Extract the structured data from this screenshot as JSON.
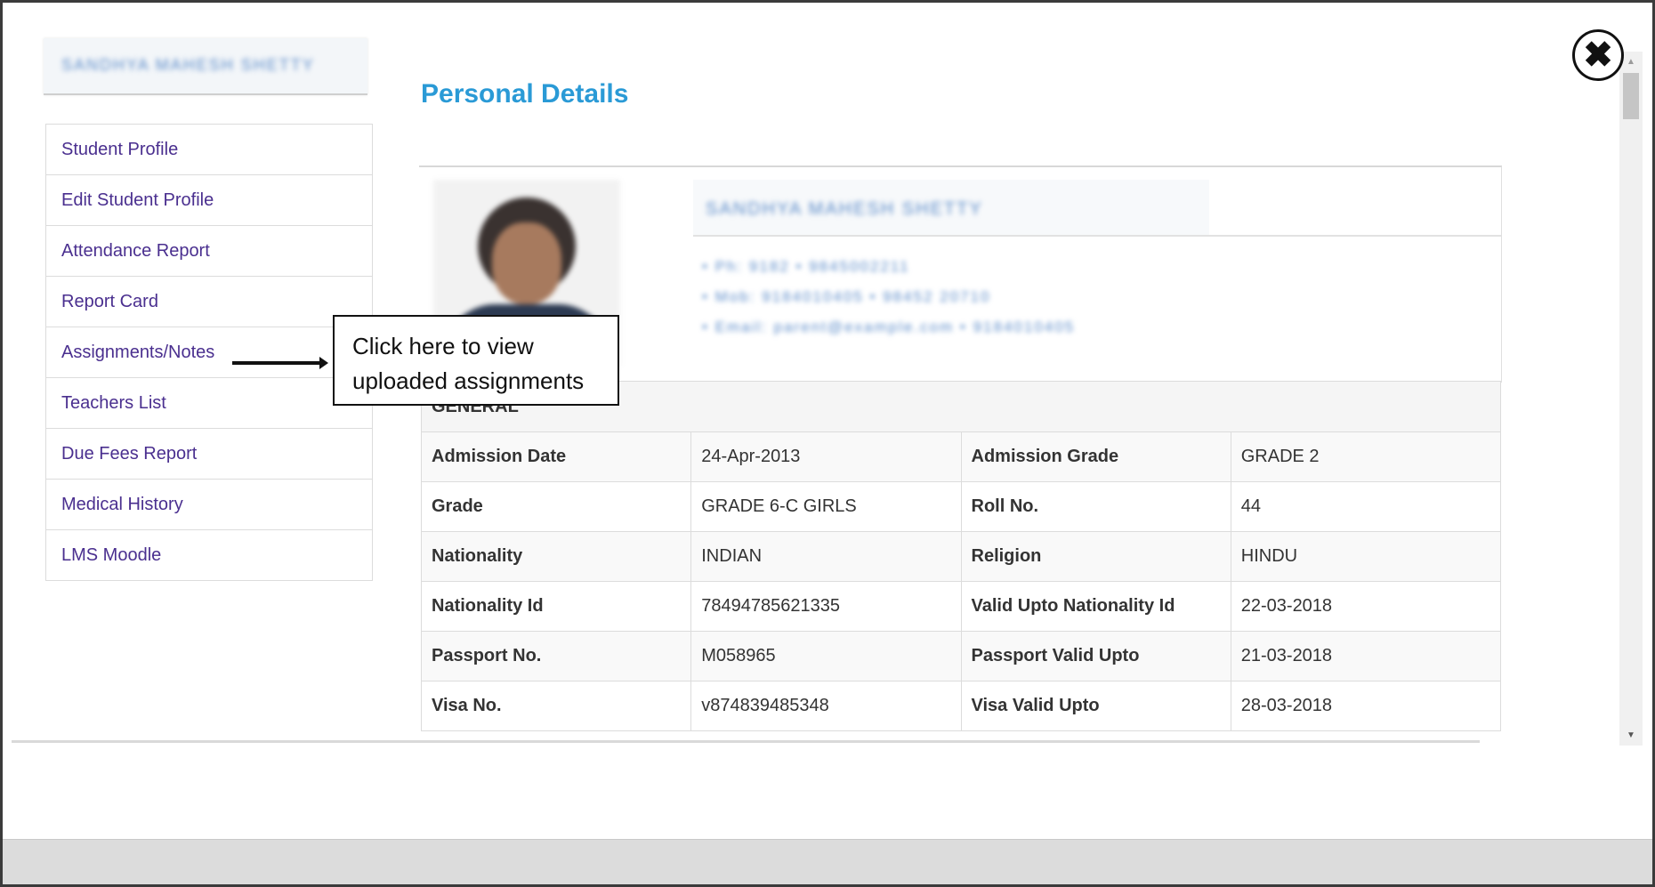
{
  "student": {
    "name_blurred": "SANDHYA MAHESH SHETTY",
    "detail_line_1": "• Ph: 9182 • 9845002211",
    "detail_line_2": "• Mob: 9184010405 • 98452 20710",
    "detail_line_3": "• Email: parent@example.com • 9184010405"
  },
  "sidebar": {
    "items": [
      {
        "label": "Student Profile"
      },
      {
        "label": "Edit Student Profile"
      },
      {
        "label": "Attendance Report"
      },
      {
        "label": "Report Card"
      },
      {
        "label": "Assignments/Notes"
      },
      {
        "label": "Teachers List"
      },
      {
        "label": "Due Fees Report"
      },
      {
        "label": "Medical History"
      },
      {
        "label": "LMS Moodle"
      }
    ]
  },
  "main": {
    "title": "Personal Details",
    "section_label": "GENERAL",
    "rows": [
      {
        "l1": "Admission Date",
        "v1": "24-Apr-2013",
        "l2": "Admission Grade",
        "v2": "GRADE 2"
      },
      {
        "l1": "Grade",
        "v1": "GRADE 6-C GIRLS",
        "l2": "Roll No.",
        "v2": "44"
      },
      {
        "l1": "Nationality",
        "v1": "INDIAN",
        "l2": "Religion",
        "v2": "HINDU"
      },
      {
        "l1": "Nationality Id",
        "v1": "78494785621335",
        "l2": "Valid Upto Nationality Id",
        "v2": "22-03-2018"
      },
      {
        "l1": "Passport No.",
        "v1": "M058965",
        "l2": "Passport Valid Upto",
        "v2": "21-03-2018"
      },
      {
        "l1": "Visa No.",
        "v1": "v874839485348",
        "l2": "Visa Valid Upto",
        "v2": "28-03-2018"
      }
    ]
  },
  "callout": {
    "line1": "Click here to view",
    "line2": "uploaded assignments"
  },
  "icons": {
    "close": "close-icon",
    "scroll_up": "scroll-up-icon",
    "scroll_down": "scroll-down-icon",
    "pointer": "arrow-right-icon"
  },
  "colors": {
    "title": "#2a9ad6",
    "menu_link": "#4a2f8f"
  }
}
